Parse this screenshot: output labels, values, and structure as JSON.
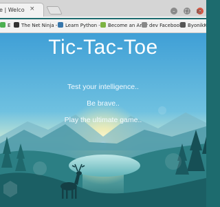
{
  "browser": {
    "tab_title": "e | Welco",
    "tab_close": "×",
    "win_min": "–",
    "win_max": "□",
    "win_close": "×",
    "bookmarks": [
      {
        "label": "E",
        "color": "#4caf50"
      },
      {
        "label": "The Net Ninja - Y",
        "color": "#333333"
      },
      {
        "label": "Learn Python - F",
        "color": "#3776ab"
      },
      {
        "label": "Become an Andr",
        "color": "#7cb342"
      },
      {
        "label": "dev Facebook",
        "color": "#888888"
      },
      {
        "label": "ByonikKMD / PC",
        "color": "#555555"
      }
    ]
  },
  "page": {
    "title": "Tic-Tac-Toe",
    "lines": [
      "Test your intelligence..",
      "Be brave..",
      "Play the ultimate game.."
    ]
  }
}
